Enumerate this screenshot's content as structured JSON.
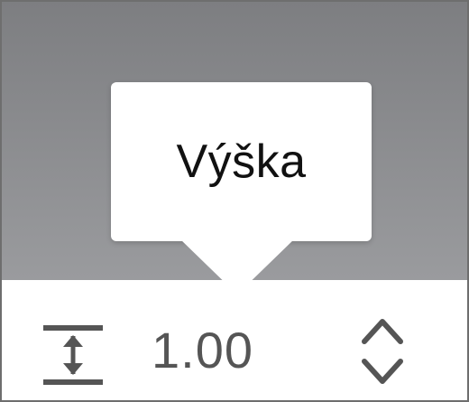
{
  "tooltip": {
    "label": "Výška"
  },
  "control": {
    "value": "1.00",
    "icon": "line-spacing-height-icon",
    "stepper_up_icon": "chevron-up-icon",
    "stepper_down_icon": "chevron-down-icon"
  },
  "colors": {
    "backdrop": "#8d8e91",
    "tooltip_background": "#ffffff",
    "tooltip_text": "#111111",
    "value_text": "#555555",
    "icon": "#555555"
  }
}
